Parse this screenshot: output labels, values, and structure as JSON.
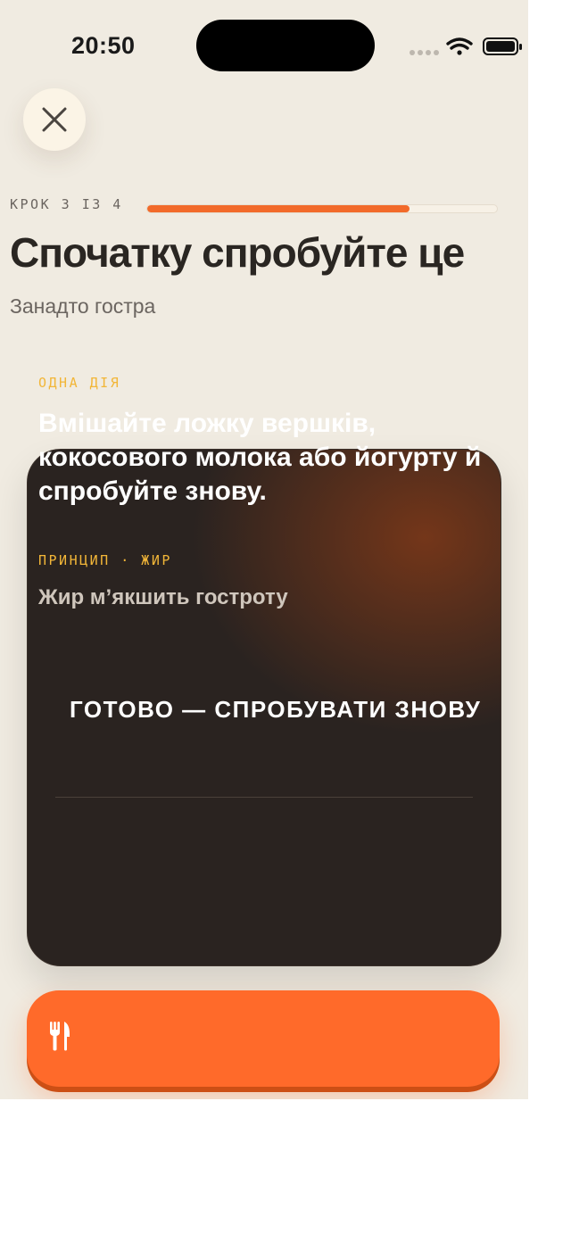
{
  "status_bar": {
    "time": "20:50"
  },
  "step": {
    "label": "КРОК 3 ІЗ 4",
    "progress": 0.75
  },
  "header": {
    "title": "Спочатку спробуйте це",
    "subtitle": "Занадто гостра"
  },
  "card": {
    "action_label": "ОДНА ДІЯ",
    "action_text": "Вмішайте ложку вершків, кокосового молока або йогурту й спробуйте знову.",
    "principle_label": "ПРИНЦИП · ЖИР",
    "principle_text": "Жир м’якшить гостроту",
    "retry_label": "ГОТОВО — СПРОБУВАТИ ЗНОВУ"
  },
  "colors": {
    "accent": "#ff6a2a",
    "progress": "#f26a2a",
    "label_gold": "#f2b638",
    "background": "#f0ebe1",
    "card": "#2a2320"
  },
  "icons": {
    "close": "close-icon",
    "wifi": "wifi-icon",
    "battery": "battery-icon",
    "signal": "signal-icon",
    "fork_knife": "fork-knife-icon"
  }
}
